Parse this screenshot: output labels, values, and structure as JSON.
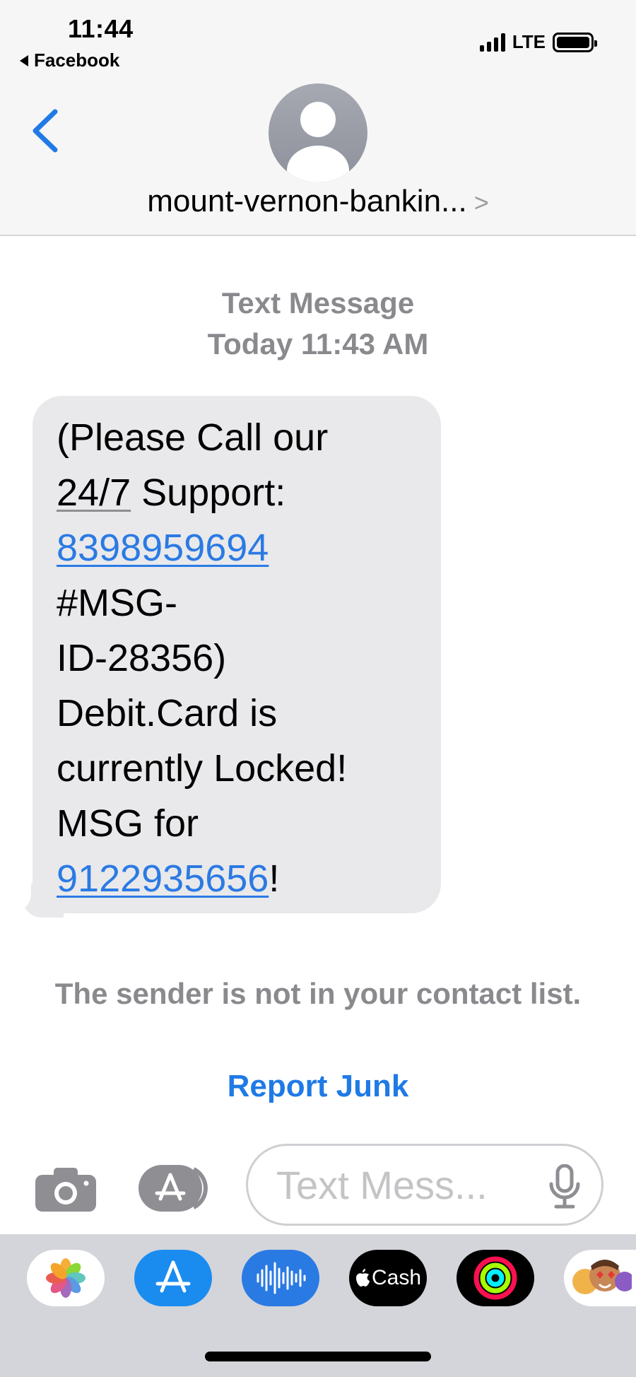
{
  "status_bar": {
    "time": "11:44",
    "back_app": "Facebook",
    "network": "LTE"
  },
  "header": {
    "contact_name": "mount-vernon-bankin...",
    "chevron": ">"
  },
  "conversation": {
    "service": "Text Message",
    "timestamp": "Today 11:43 AM"
  },
  "message": {
    "line1": "(Please Call our",
    "line2_underlined": "24/7",
    "line2_rest": " Support:",
    "phone1": "8398959694",
    "line4": "#MSG-",
    "line5": "ID-28356)",
    "line6": "Debit.Card is",
    "line7": "currently Locked!",
    "line8": "MSG for",
    "phone2": "9122935656",
    "line9_suffix": "!"
  },
  "notice": {
    "text": "The sender is not in your contact list.",
    "report_label": "Report Junk"
  },
  "input": {
    "placeholder": "Text Mess..."
  },
  "app_drawer": {
    "items": [
      {
        "name": "photos",
        "icon": "photos-icon"
      },
      {
        "name": "app-store",
        "icon": "app-store-icon"
      },
      {
        "name": "audio-message",
        "icon": "audio-waveform-icon"
      },
      {
        "name": "cash",
        "icon": "apple-cash-icon",
        "label": "Cash"
      },
      {
        "name": "activity",
        "icon": "activity-rings-icon"
      },
      {
        "name": "memoji",
        "icon": "memoji-icon"
      }
    ]
  },
  "colors": {
    "accent_blue": "#1f7ae6",
    "bubble_gray": "#e9e9eb",
    "meta_gray": "#8a8a8e"
  }
}
